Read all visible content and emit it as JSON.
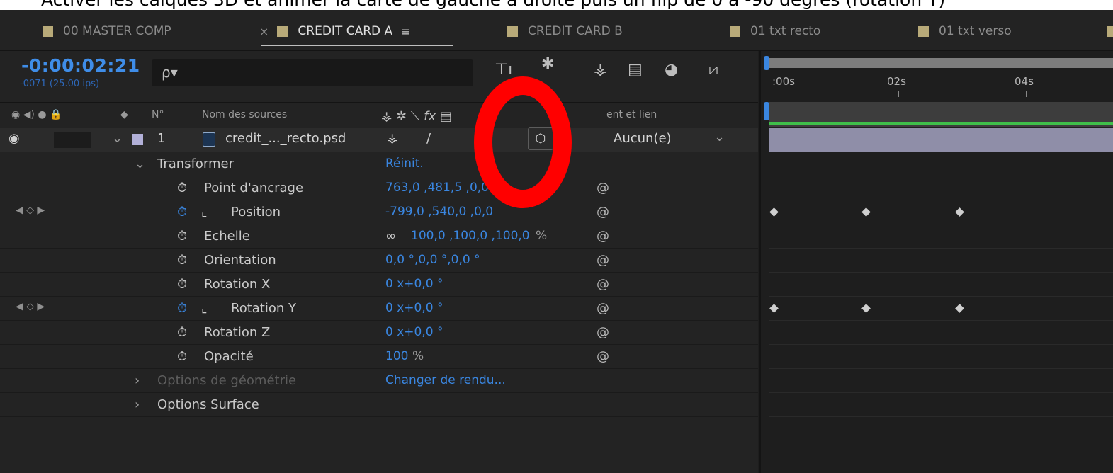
{
  "caption": "Activer les calques 3D et animer la carte de gauche à droite puis un flip de 0 à -90 degrés (rotation Y)",
  "tabs": [
    {
      "label": "00 MASTER COMP",
      "active": false
    },
    {
      "label": "CREDIT CARD A",
      "active": true
    },
    {
      "label": "CREDIT CARD B",
      "active": false
    },
    {
      "label": "01 txt recto",
      "active": false
    },
    {
      "label": "01 txt verso",
      "active": false
    }
  ],
  "tab_close": "×",
  "tab_menu": "≡",
  "timecode": "-0:00:02:21",
  "framecode": "-0071 (25.00 ips)",
  "search": {
    "icon": "ρ▾"
  },
  "column_headers": {
    "num": "N°",
    "source_name": "Nom des sources",
    "parent": "ent et lien"
  },
  "layer": {
    "number": "1",
    "name": "credit_..._recto.psd",
    "parent_value": "Aucun(e)"
  },
  "group_label": "Transformer",
  "reset_label": "Réinit.",
  "properties": [
    {
      "name": "Point d'ancrage",
      "value": "763,0 ,481,5 ,0,0",
      "keyed": false
    },
    {
      "name": "Position",
      "value": "-799,0 ,540,0 ,0,0",
      "keyed": true
    },
    {
      "name": "Echelle",
      "value": "100,0 ,100,0 ,100,0",
      "unit": "%",
      "keyed": false
    },
    {
      "name": "Orientation",
      "value": "0,0 °,0,0 °,0,0 °",
      "keyed": false
    },
    {
      "name": "Rotation X",
      "value": "0 x+0,0 °",
      "keyed": false
    },
    {
      "name": "Rotation Y",
      "value": "0 x+0,0 °",
      "keyed": true
    },
    {
      "name": "Rotation Z",
      "value": "0 x+0,0 °",
      "keyed": false
    },
    {
      "name": "Opacité",
      "value": "100",
      "unit": "%",
      "keyed": false
    }
  ],
  "geometry_options": "Options de géométrie",
  "change_render": "Changer de rendu...",
  "surface_options": "Options Surface",
  "ruler_labels": [
    ":00s",
    "02s",
    "04s"
  ],
  "colors": {
    "accent_blue": "#3a86e0",
    "annotation_red": "#ff0000",
    "layer_bar": "#8f8ea8",
    "tab_swatch": "#b8aa79"
  }
}
